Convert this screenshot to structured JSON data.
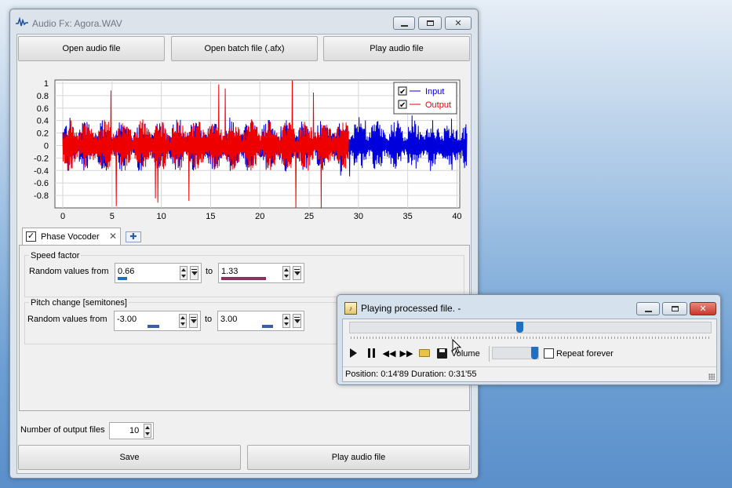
{
  "main_window": {
    "title": "Audio Fx: Agora.WAV",
    "buttons": {
      "open_audio": "Open audio file",
      "open_batch": "Open batch file (.afx)",
      "play_audio_top": "Play audio file",
      "save": "Save",
      "play_audio_bottom": "Play audio file"
    },
    "chart": {
      "legend_input": "Input",
      "legend_output": "Output",
      "y_ticks": [
        "1",
        "0.8",
        "0.6",
        "0.4",
        "0.2",
        "0",
        "-0.2",
        "-0.4",
        "-0.6",
        "-0.8"
      ],
      "x_ticks": [
        "0",
        "5",
        "10",
        "15",
        "20",
        "25",
        "30",
        "35",
        "40"
      ]
    },
    "tab": {
      "label": "Phase Vocoder"
    },
    "speed": {
      "title": "Speed factor",
      "label": "Random values from",
      "from": "0.66",
      "to_label": "to",
      "to": "1.33"
    },
    "pitch": {
      "title": "Pitch change [semitones]",
      "label": "Random values from",
      "from": "-3.00",
      "to_label": "to",
      "to": "3.00"
    },
    "output_files": {
      "label": "Number of output files",
      "value": "10"
    }
  },
  "player": {
    "title": "Playing processed file. -",
    "volume_label": "Volume",
    "repeat_label": "Repeat forever",
    "status": "Position: 0:14'89 Duration: 0:31'55"
  },
  "chart_data": {
    "type": "line",
    "x_range": [
      0,
      41
    ],
    "y_range": [
      -1,
      1.05
    ],
    "grid": true,
    "legend_position": "top-right",
    "series": [
      {
        "name": "Input",
        "color": "#0000dd",
        "approx_x_extent": [
          0,
          41
        ],
        "typical_amplitude": 0.3,
        "peak_amplitude": 0.5
      },
      {
        "name": "Output",
        "color": "#ee0000",
        "approx_x_extent": [
          0,
          29
        ],
        "typical_amplitude": 0.3,
        "peak_amplitude": 1.05
      }
    ]
  },
  "colors": {
    "input_series": "#0000dd",
    "output_series": "#ee0000",
    "speed_from_bar": "#1f6fc4",
    "speed_to_bar": "#8e2f5f",
    "pitch_bar": "#3b5ea8",
    "slider_thumb": "#1f6fc4",
    "close_button": "#c9382a"
  }
}
